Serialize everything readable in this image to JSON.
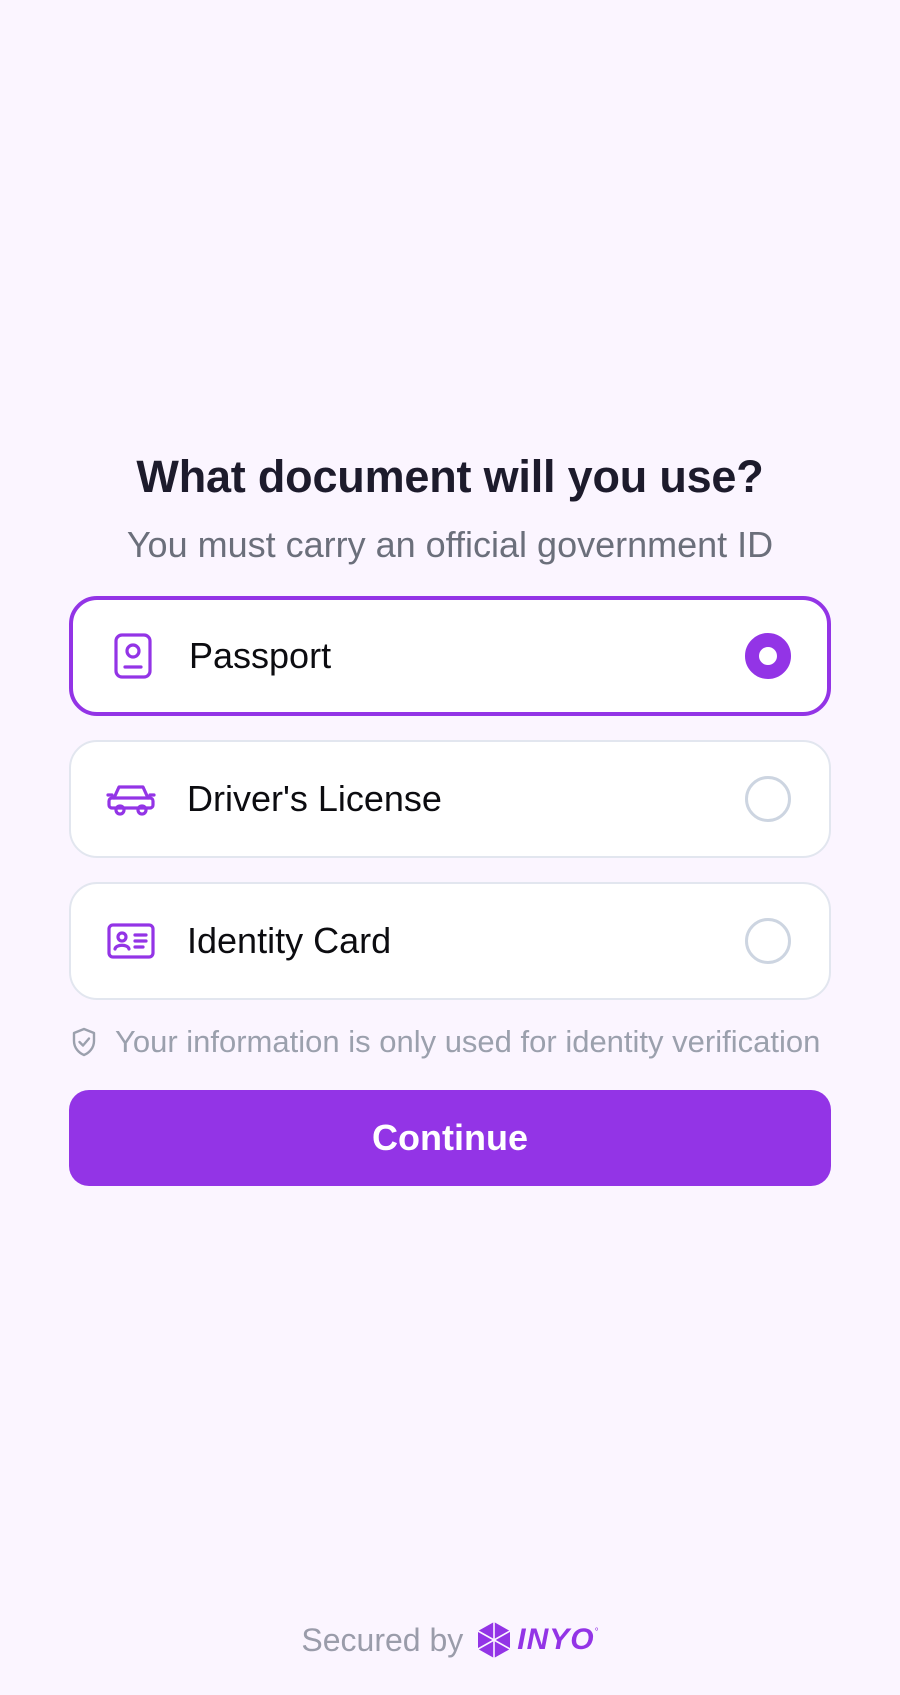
{
  "header": {
    "title": "What document will you use?",
    "subtitle": "You must carry an official government ID"
  },
  "options": [
    {
      "label": "Passport",
      "icon": "passport-icon",
      "selected": true
    },
    {
      "label": "Driver's License",
      "icon": "car-icon",
      "selected": false
    },
    {
      "label": "Identity Card",
      "icon": "id-card-icon",
      "selected": false
    }
  ],
  "privacy_note": {
    "icon": "shield-check-icon",
    "text": "Your information is only used for identity verification"
  },
  "continue_button": {
    "label": "Continue"
  },
  "footer": {
    "secured_by": "Secured by",
    "brand": "INYO"
  },
  "colors": {
    "accent": "#9334e6",
    "background": "#fbf5ff",
    "title": "#1d1b2c",
    "muted": "#9ba0ad"
  }
}
